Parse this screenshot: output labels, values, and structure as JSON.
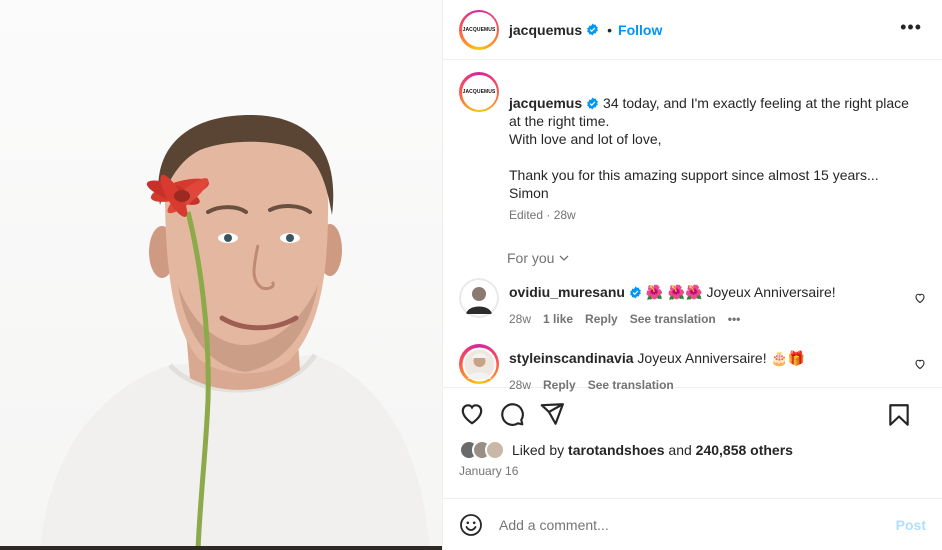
{
  "post": {
    "username": "jacquemus",
    "avatar_text": "JACQUEMUS",
    "follow_label": "Follow",
    "separator": "•",
    "more_label": "•••"
  },
  "caption": {
    "username": "jacquemus",
    "text": "34 today, and I'm exactly feeling at the right place at the right time.\nWith love and lot of love,\n\nThank you for this amazing support since almost 15 years...\nSimon",
    "edited": "Edited",
    "time": "28w"
  },
  "for_you_label": "For you",
  "comments": [
    {
      "username": "ovidiu_muresanu",
      "emojis": "🌺 🌺🌺",
      "text": "Joyeux Anniversaire!",
      "time": "28w",
      "likes": "1 like",
      "reply": "Reply",
      "translate": "See translation",
      "more": "•••"
    },
    {
      "username": "styleinscandinavia",
      "text": "Joyeux Anniversaire!",
      "emojis": "🎂🎁",
      "time": "28w",
      "reply": "Reply",
      "translate": "See translation"
    }
  ],
  "likes": {
    "prefix": "Liked by",
    "user": "tarotandshoes",
    "and": "and",
    "others": "240,858 others"
  },
  "date": "January 16",
  "add_comment": {
    "placeholder": "Add a comment...",
    "post_label": "Post"
  },
  "colors": {
    "accent": "#0095f6",
    "post_disabled": "#b2dffc",
    "muted": "#737373"
  },
  "icons": [
    "verified-icon",
    "more-icon",
    "chevron-down-icon",
    "heart-icon",
    "comment-icon",
    "share-icon",
    "bookmark-icon",
    "smile-icon"
  ]
}
